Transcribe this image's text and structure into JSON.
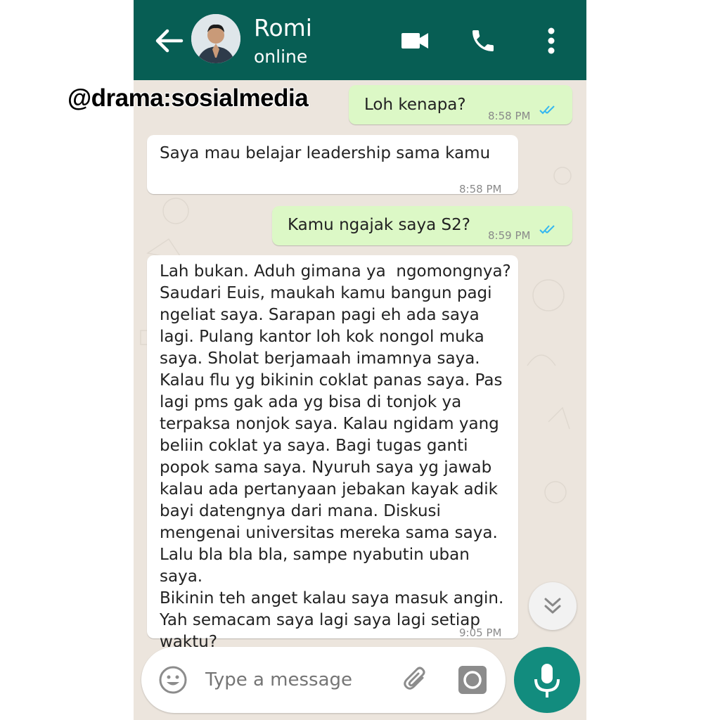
{
  "colors": {
    "header": "#075E54",
    "outgoing": "#DCF8C6",
    "incoming": "#FFFFFF",
    "background": "#ECE5DD",
    "mic": "#128C7E",
    "read_ticks": "#34B7F1"
  },
  "header": {
    "contact_name": "Romi",
    "status": "online",
    "icons": [
      "back-arrow-icon",
      "video-call-icon",
      "phone-call-icon",
      "more-options-icon"
    ]
  },
  "watermark": "@drama:sosialmedia",
  "messages": [
    {
      "direction": "out",
      "text": "Loh kenapa?",
      "time": "8:58 PM",
      "read": true
    },
    {
      "direction": "in",
      "text": "Saya mau belajar leadership sama kamu",
      "time": "8:58 PM"
    },
    {
      "direction": "out",
      "text": "Kamu ngajak saya S2?",
      "time": "8:59 PM",
      "read": true
    },
    {
      "direction": "in",
      "text": "Lah bukan. Aduh gimana ya  ngomongnya?\nSaudari Euis, maukah kamu bangun pagi\nngeliat saya. Sarapan pagi eh ada saya\nlagi. Pulang kantor loh kok nongol muka\nsaya. Sholat berjamaah imamnya saya.\nKalau flu yg bikinin coklat panas saya. Pas\nlagi pms gak ada yg bisa di tonjok ya\nterpaksa nonjok saya. Kalau ngidam yang\nbeliin coklat ya saya. Bagi tugas ganti\npopok sama saya. Nyuruh saya yg jawab\nkalau ada pertanyaan jebakan kayak adik\nbayi datengnya dari mana. Diskusi\nmengenai universitas mereka sama saya.\nLalu bla bla bla, sampe nyabutin uban saya.\nBikinin teh anget kalau saya masuk angin.\nYah semacam saya lagi saya lagi setiap\nwaktu?",
      "time": "9:05 PM"
    }
  ],
  "composer": {
    "placeholder": "Type a message",
    "icons": [
      "emoji-icon",
      "attach-icon",
      "camera-icon",
      "mic-icon"
    ]
  },
  "scroll_button_icon": "double-chevron-down-icon"
}
